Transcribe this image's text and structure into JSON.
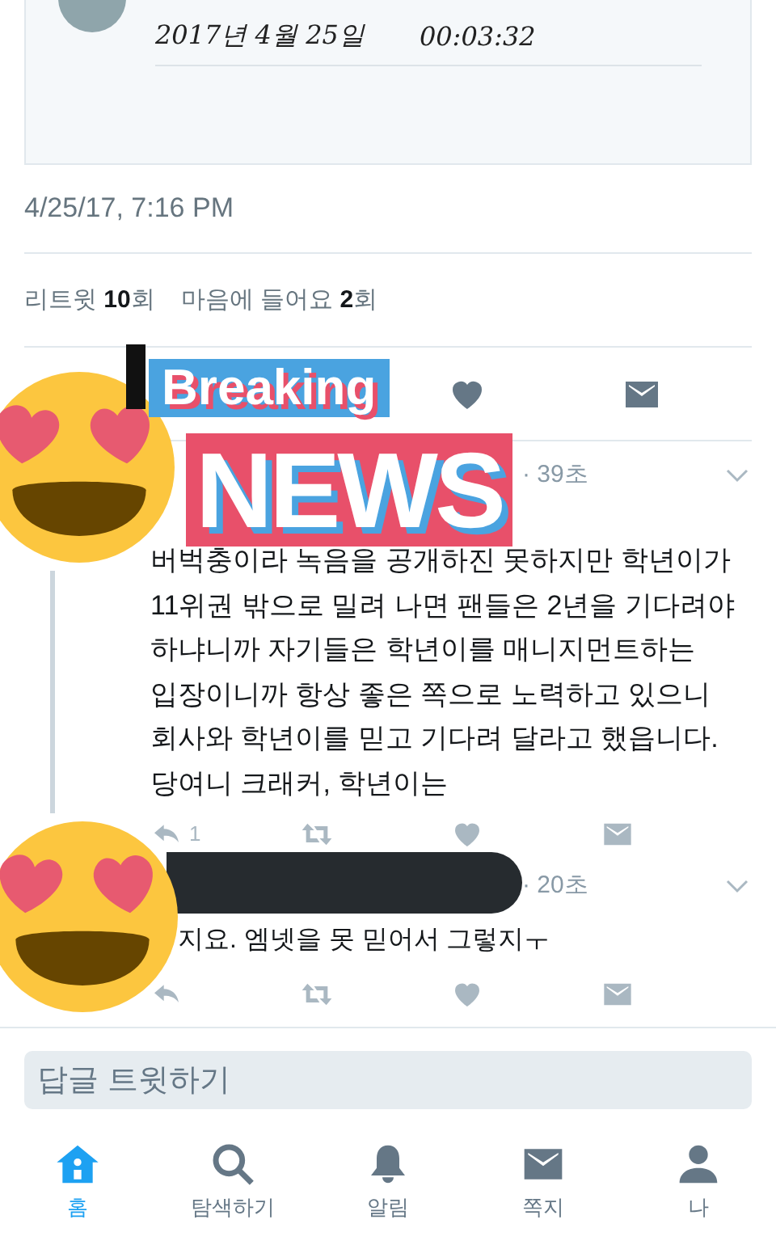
{
  "media_card": {
    "date": "2017년 4월 25일",
    "time": "00:03:32"
  },
  "timestamp": "4/25/17, 7:16 PM",
  "stats": [
    "리트윗 **10**회",
    "마음에 들어요 **2**회"
  ],
  "main_actions": [
    {
      "kind": "like"
    },
    {
      "kind": "message"
    }
  ],
  "replies": [
    {
      "redacted": false,
      "time": "· 39초",
      "text": "버벅충이라 녹음을 공개하진 못하지만 학년이가 11위권 밖으로 밀려 나면 팬들은 2년을 기다려야 하냐니까 자기들은 학년이를 매니지먼트하는 입장이니까 항상 좋은 쪽으로 노력하고 있으니 회사와 학년이를 믿고 기다려 달라고 했읍니다. 당여니 크래커, 학년이는",
      "thread": true,
      "actions": [
        {
          "kind": "reply",
          "count": "1"
        },
        {
          "kind": "retweet"
        },
        {
          "kind": "like"
        },
        {
          "kind": "message"
        }
      ]
    },
    {
      "redacted": true,
      "time": "· 20초",
      "text": "지요. 엠넷을 못 믿어서 그렇지ㅜ",
      "thread": false,
      "actions": [
        {
          "kind": "reply"
        },
        {
          "kind": "retweet"
        },
        {
          "kind": "like"
        },
        {
          "kind": "message"
        }
      ]
    }
  ],
  "reply_field": {
    "placeholder": "답글 트윗하기"
  },
  "tabs": [
    {
      "kind": "home",
      "label": "홈",
      "selected": true
    },
    {
      "kind": "search",
      "label": "탐색하기",
      "selected": false
    },
    {
      "kind": "bell",
      "label": "알림",
      "selected": false
    },
    {
      "kind": "mail",
      "label": "쪽지",
      "selected": false
    },
    {
      "kind": "person",
      "label": "나",
      "selected": false
    }
  ],
  "stickers": [
    {
      "kind": "emoji"
    },
    {
      "kind": "news",
      "line_1": "Breaking",
      "line_2": "NEWS"
    },
    {
      "kind": "emoji"
    }
  ]
}
